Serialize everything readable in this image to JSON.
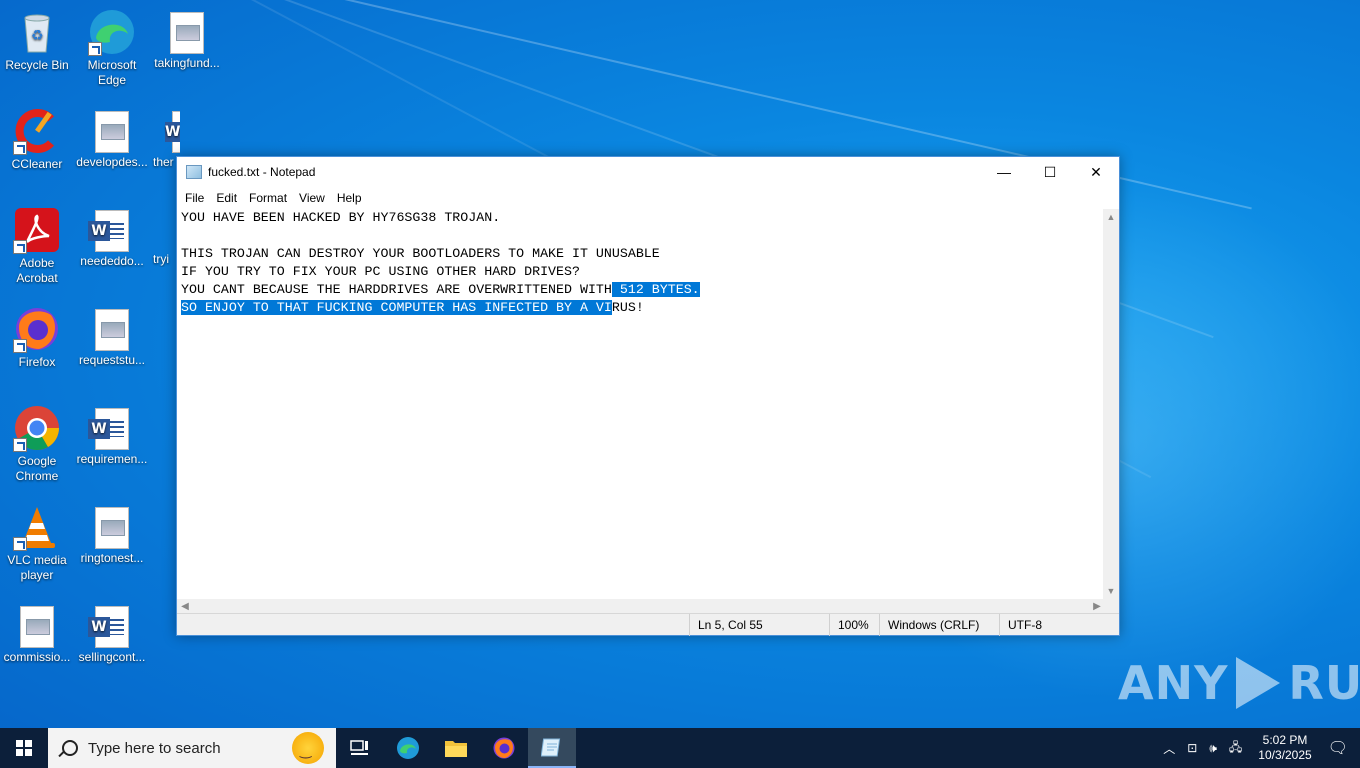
{
  "desktop": {
    "icons": [
      {
        "label": "Recycle Bin"
      },
      {
        "label": "Microsoft Edge"
      },
      {
        "label": "takingfund..."
      },
      {
        "label": "CCleaner"
      },
      {
        "label": "developdes..."
      },
      {
        "label": "ther"
      },
      {
        "label": "Adobe Acrobat"
      },
      {
        "label": "neededdo..."
      },
      {
        "label": "tryi"
      },
      {
        "label": "Firefox"
      },
      {
        "label": "requeststu..."
      },
      {
        "label": "Google Chrome"
      },
      {
        "label": "requiremen..."
      },
      {
        "label": "VLC media player"
      },
      {
        "label": "ringtonest..."
      },
      {
        "label": "commissio..."
      },
      {
        "label": "sellingcont..."
      }
    ]
  },
  "notepad": {
    "title": "fucked.txt - Notepad",
    "menu": [
      "File",
      "Edit",
      "Format",
      "View",
      "Help"
    ],
    "lines": {
      "l1": "YOU HAVE BEEN HACKED BY HY76SG38 TROJAN.",
      "l2": "",
      "l3": "THIS TROJAN CAN DESTROY YOUR BOOTLOADERS TO MAKE IT UNUSABLE",
      "l4": "IF YOU TRY TO FIX YOUR PC USING OTHER HARD DRIVES?",
      "l5a": "YOU CANT BECAUSE THE HARDDRIVES ARE OVERWRITTENED WITH",
      "l5b": " 512 BYTES.",
      "l6a": "SO ENJOY TO THAT FUCKING COMPUTER HAS INFECTED BY A VI",
      "l6b": "RUS!"
    },
    "status": {
      "position": "Ln 5, Col 55",
      "zoom": "100%",
      "line_ending": "Windows (CRLF)",
      "encoding": "UTF-8"
    }
  },
  "watermark": {
    "left": "ANY",
    "right": "RUN"
  },
  "taskbar": {
    "search_placeholder": "Type here to search",
    "time": "5:02 PM",
    "date": "10/3/2025"
  }
}
